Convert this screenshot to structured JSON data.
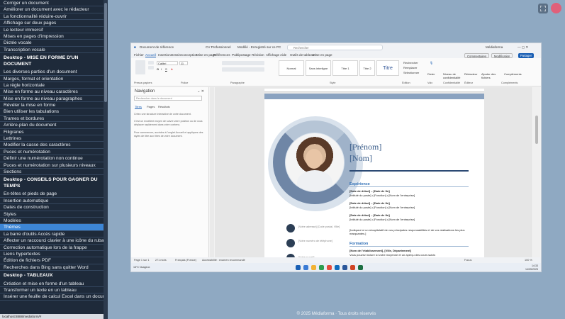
{
  "sidebar": {
    "items": [
      {
        "type": "lesson",
        "label": "Corriger un document"
      },
      {
        "type": "lesson",
        "label": "Améliorer un document avec le rédacteur"
      },
      {
        "type": "lesson",
        "label": "La fonctionnalité réduire-ouvrir"
      },
      {
        "type": "lesson",
        "label": "Affichage sur deux pages"
      },
      {
        "type": "lesson",
        "label": "Le lecteur immersif"
      },
      {
        "type": "lesson",
        "label": "Mises en pages d'impression"
      },
      {
        "type": "lesson",
        "label": "Dictée vocale"
      },
      {
        "type": "lesson",
        "label": "Transcription vocale"
      },
      {
        "type": "section",
        "label": "Desktop - MISE EN FORME D'UN DOCUMENT"
      },
      {
        "type": "lesson",
        "label": "Les diverses parties d'un document"
      },
      {
        "type": "lesson",
        "label": "Marges, format et orientation"
      },
      {
        "type": "lesson",
        "label": "La règle horizontale"
      },
      {
        "type": "lesson",
        "label": "Mise en forme au niveau caractères"
      },
      {
        "type": "lesson",
        "label": "Mise en forme au niveau paragraphes"
      },
      {
        "type": "lesson",
        "label": "Révéler la mise en forme"
      },
      {
        "type": "lesson",
        "label": "Bien utiliser les tabulations"
      },
      {
        "type": "lesson",
        "label": "Trames et bordures"
      },
      {
        "type": "lesson",
        "label": "Arrière-plan du document"
      },
      {
        "type": "lesson",
        "label": "Filigranes"
      },
      {
        "type": "lesson",
        "label": "Lettrines"
      },
      {
        "type": "lesson",
        "label": "Modifier la casse des caractères"
      },
      {
        "type": "lesson",
        "label": "Puces et numérotation"
      },
      {
        "type": "lesson",
        "label": "Définir une numérotation non continue"
      },
      {
        "type": "lesson",
        "label": "Puces et numérotation sur plusieurs niveaux"
      },
      {
        "type": "lesson",
        "label": "Sections"
      },
      {
        "type": "section",
        "label": "Desktop - CONSEILS POUR GAGNER DU TEMPS"
      },
      {
        "type": "lesson",
        "label": "En-têtes et pieds de page"
      },
      {
        "type": "lesson",
        "label": "Insertion automatique"
      },
      {
        "type": "lesson",
        "label": "Dates de construction"
      },
      {
        "type": "lesson",
        "label": "Styles"
      },
      {
        "type": "lesson",
        "label": "Modèles"
      },
      {
        "type": "lesson",
        "label": "Thèmes",
        "active": true
      },
      {
        "type": "lesson",
        "label": "La barre d'outils Accès rapide"
      },
      {
        "type": "lesson",
        "label": "Affecter un raccourci clavier à une icône du ruban"
      },
      {
        "type": "lesson",
        "label": "Correction automatique lors de la frappe"
      },
      {
        "type": "lesson",
        "label": "Liens hypertextes"
      },
      {
        "type": "lesson",
        "label": "Édition de fichiers PDF"
      },
      {
        "type": "lesson",
        "label": "Recherches dans Bing sans quitter Word"
      },
      {
        "type": "section",
        "label": "Desktop - TABLEAUX"
      },
      {
        "type": "lesson",
        "label": "Création et mise en forme d'un tableau"
      },
      {
        "type": "lesson",
        "label": "Transformer un texte en un tableau"
      },
      {
        "type": "lesson",
        "label": "Insérer une feuille de calcul Excel dans un document Word"
      }
    ],
    "status_url": "localhost:8888/mediaform/#"
  },
  "footer": {
    "copyright": "© 2025 Médiaforma · Tous droits réservés"
  },
  "word": {
    "titlebar": {
      "doc_name": "Document de référence",
      "autosave": "CV Professionnel",
      "save_state": "Modifié - Enregistré sur ce PC",
      "search_placeholder": "Rechercher",
      "user": "Médiaforma"
    },
    "menu": {
      "tabs": [
        "Fichier",
        "Accueil",
        "Insertion",
        "Dessin",
        "Conception",
        "Mise en page",
        "Références",
        "Publipostage",
        "Révision",
        "Affichage",
        "Aide",
        "Outils de tableau",
        "Mise en page"
      ],
      "active_index": 1,
      "comments_label": "Commentaires",
      "edit_label": "Modification",
      "share_label": "Partager"
    },
    "ribbon": {
      "font_name": "Calibri",
      "font_size": "11",
      "styles": [
        "Normal",
        "Sans interligne",
        "Titre 1",
        "Titre 2",
        "Titre"
      ],
      "group_labels": [
        "Presse-papiers",
        "Police",
        "Paragraphe",
        "Style",
        "Édition",
        "Voix",
        "Confidentialité",
        "Éditeur",
        "Compléments"
      ],
      "edit_items": [
        "Rechercher",
        "Remplacer",
        "Sélectionner"
      ],
      "tool_labels": [
        "Dicter",
        "Niveau de confidentialité",
        "Rédacteur",
        "Ajouter des fichiers",
        "Compléments"
      ]
    },
    "navigation": {
      "title": "Navigation",
      "search_placeholder": "Rechercher dans le document",
      "tabs": [
        "Titres",
        "Pages",
        "Résultats"
      ],
      "text1": "Créez une structure interactive de votre document.",
      "text2": "C'est un excellent moyen de suivre votre position ou de vous déplacer rapidement dans votre contenu.",
      "text3": "Pour commencer, accédez à l'onglet Accueil et appliquez des styles de titre aux titres de votre document."
    },
    "resume": {
      "first_name": "[Prénom]",
      "last_name": "[Nom]",
      "experience_heading": "Expérience",
      "entries": [
        {
          "date": "[Date de début] – [Date de fin]",
          "title": "[Intitulé du poste] • [Fonction] • [Nom de l'entreprise]"
        },
        {
          "date": "[Date de début] – [Date de fin]",
          "title": "[Intitulé du poste] • [Fonction] • [Nom de l'entreprise]"
        },
        {
          "date": "[Date de début] – [Date de fin]",
          "title": "[Intitulé du poste] • [Fonction] • [Nom de l'entreprise]"
        }
      ],
      "summary": "[Indiquez ici un récapitulatif de vos principales responsabilités et de vos réalisations les plus marquantes.]",
      "education_heading": "Formation",
      "education_line": "[Nom de l'établissement], [Ville, Département]",
      "education_detail": "Vous pouvez inclure ici votre moyenne et un aperçu des cours suivis",
      "contacts": [
        "[Votre adresse] [Code postal, Ville]",
        "[Votre numéro de téléphone]",
        "[Votre e-mail]"
      ]
    },
    "status": {
      "page": "Page 1 sur 1",
      "words": "271 mots",
      "language": "Français (France)",
      "accessibility": "Accessibilité : examen recommandé",
      "focus": "Focus",
      "zoom": "100 %"
    },
    "taskbar": {
      "weather": "16°C Nuageux",
      "time": "14:33",
      "date": "14/05/2025"
    }
  },
  "colors": {
    "sidebar_bg": "#1e2a3a",
    "active_lesson": "#3d86d6",
    "page_bg": "#8fa9c2",
    "resume_accent": "#2f6fb6"
  }
}
